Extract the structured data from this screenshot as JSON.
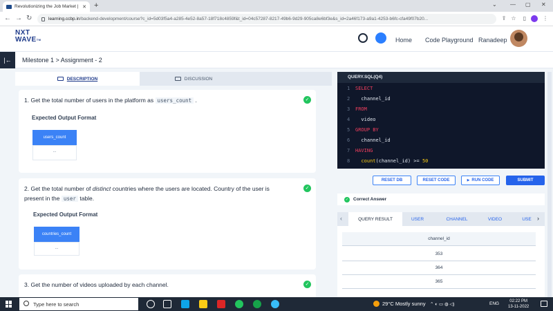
{
  "browser": {
    "tab_title": "Revolutionizing the Job Market |",
    "url_domain": "learning.ccbp.in",
    "url_rest": "/backend-development/course?c_id=5d03f5a4-a285-4e52-8a57-18f718c4859f&t_id=04c57287-8217-49b6-9d29-905ca8e6bf3e&s_id=2a46f173-a9a1-4253-b6fc-cfa49f07b20..."
  },
  "header": {
    "logo_line1": "NXT",
    "logo_line2": "WAVE",
    "logo_tm": "TM",
    "nav_home": "Home",
    "nav_playground": "Code Playground",
    "user_name": "Ranadeep"
  },
  "breadcrumb": "Milestone 1 > Assignment - 2",
  "left_tabs": {
    "description": "DESCRIPTION",
    "discussion": "DISCUSSION"
  },
  "questions": [
    {
      "number": "1.",
      "pre": "Get the total number of users in the platform as",
      "code": "users_count",
      "post": ".",
      "expected_label": "Expected Output Format",
      "column": "users_count",
      "dots": "..."
    },
    {
      "number": "2.",
      "pre": "Get the total number of",
      "emph": "distinct",
      "mid": "countries where the users are located. Country of the user is present in the",
      "code": "user",
      "post": "table.",
      "expected_label": "Expected Output Format",
      "column": "countries_count",
      "dots": "..."
    },
    {
      "number": "3.",
      "pre": "Get the number of videos uploaded by each channel."
    }
  ],
  "editor": {
    "title": "QUERY.SQL(Q4)",
    "lines": [
      {
        "n": "1",
        "kw": "SELECT",
        "text": ""
      },
      {
        "n": "2",
        "kw": "",
        "text": "  channel_id"
      },
      {
        "n": "3",
        "kw": "FROM",
        "text": ""
      },
      {
        "n": "4",
        "kw": "",
        "text": "  video"
      },
      {
        "n": "5",
        "kw": "GROUP BY",
        "text": ""
      },
      {
        "n": "6",
        "kw": "",
        "text": "  channel_id"
      },
      {
        "n": "7",
        "kw": "HAVING",
        "text": ""
      },
      {
        "n": "8",
        "fn": "count",
        "text": "(channel_id) >= ",
        "num": "50"
      }
    ]
  },
  "buttons": {
    "reset_db": "RESET DB",
    "reset_code": "RESET CODE",
    "run_code": "RUN CODE",
    "submit": "SUBMIT",
    "run_icon": "▶"
  },
  "status": "Correct Answer",
  "result_tabs": [
    "QUERY RESULT",
    "USER",
    "CHANNEL",
    "VIDEO",
    "USE"
  ],
  "result": {
    "column": "channel_id",
    "rows": [
      "353",
      "364",
      "365"
    ]
  },
  "taskbar": {
    "search_placeholder": "Type here to search",
    "weather": "29°C  Mostly sunny",
    "lang": "ENG",
    "time": "02:22 PM",
    "date": "13-11-2022"
  },
  "colors": {
    "accent": "#2563eb",
    "success": "#22c55e",
    "editor_bg": "#0f172a",
    "keyword": "#f43f5e"
  }
}
